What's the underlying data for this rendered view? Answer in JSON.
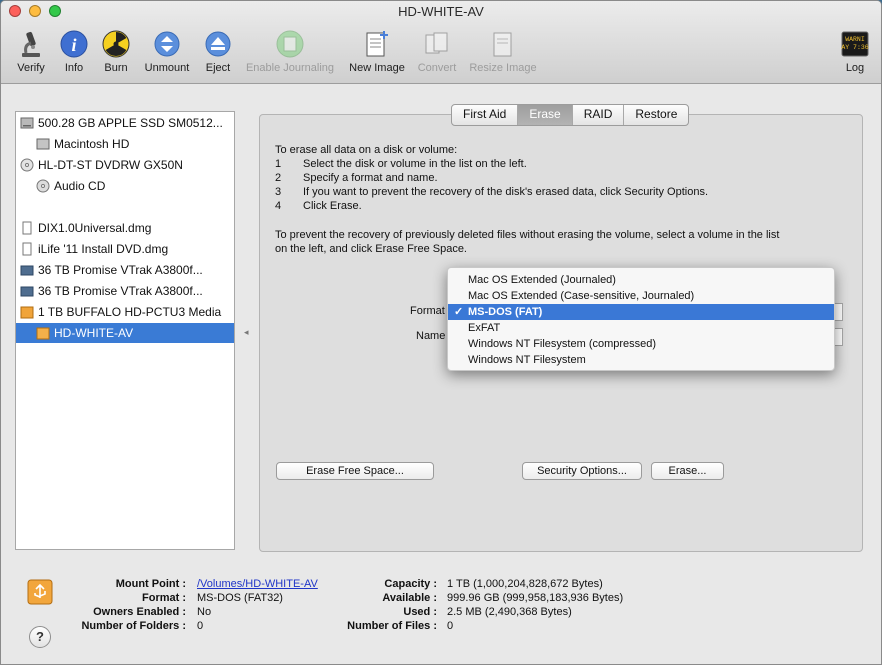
{
  "window": {
    "title": "HD-WHITE-AV"
  },
  "colors": {
    "close": "#fc605b",
    "minimize": "#fdbc40",
    "zoom": "#34c84a",
    "selection": "#3a7bd5"
  },
  "toolbar": {
    "verify": "Verify",
    "info": "Info",
    "burn": "Burn",
    "unmount": "Unmount",
    "eject": "Eject",
    "enable_journaling": "Enable Journaling",
    "new_image": "New Image",
    "convert": "Convert",
    "resize_image": "Resize Image",
    "log": "Log",
    "log_icon_text": [
      "WARNI",
      "AY 7:36"
    ]
  },
  "sidebar": {
    "items": [
      {
        "label": "500.28 GB APPLE SSD SM0512...",
        "icon": "internal-disk-icon"
      },
      {
        "label": "Macintosh HD",
        "icon": "volume-icon"
      },
      {
        "label": "HL-DT-ST DVDRW GX50N",
        "icon": "optical-drive-icon"
      },
      {
        "label": "Audio CD",
        "icon": "cd-icon"
      },
      {
        "label": "DIX1.0Universal.dmg",
        "icon": "dmg-file-icon"
      },
      {
        "label": "iLife '11 Install DVD.dmg",
        "icon": "dmg-file-icon"
      },
      {
        "label": "36 TB Promise VTrak A3800f...",
        "icon": "external-disk-icon"
      },
      {
        "label": "36 TB Promise VTrak A3800f...",
        "icon": "external-disk-icon"
      },
      {
        "label": "1 TB BUFFALO HD-PCTU3 Media",
        "icon": "usb-disk-icon"
      },
      {
        "label": "HD-WHITE-AV",
        "icon": "usb-volume-icon"
      }
    ]
  },
  "tabs": [
    "First Aid",
    "Erase",
    "RAID",
    "Restore"
  ],
  "erase": {
    "intro": "To erase all data on a disk or volume:",
    "steps": [
      {
        "n": "1",
        "text": "Select the disk or volume in the list on the left."
      },
      {
        "n": "2",
        "text": "Specify a format and name."
      },
      {
        "n": "3",
        "text": "If you want to prevent the recovery of the disk's erased data, click Security Options."
      },
      {
        "n": "4",
        "text": "Click Erase."
      }
    ],
    "free_space_line1": "To prevent the recovery of previously deleted files without erasing the volume, select a volume in the list",
    "free_space_line2": "on the left, and click Erase Free Space.",
    "format_label": "Format",
    "name_label": "Name",
    "format_options": [
      "Mac OS Extended (Journaled)",
      "Mac OS Extended (Case-sensitive, Journaled)",
      "MS-DOS (FAT)",
      "ExFAT",
      "Windows NT Filesystem (compressed)",
      "Windows NT Filesystem"
    ],
    "check_mark": "✓",
    "erase_free_space_button": "Erase Free Space...",
    "security_options_button": "Security Options...",
    "erase_button": "Erase..."
  },
  "info": {
    "mount_point_label": "Mount Point :",
    "mount_point": "/Volumes/HD-WHITE-AV",
    "format_label": "Format :",
    "format": "MS-DOS (FAT32)",
    "owners_label": "Owners Enabled :",
    "owners": "No",
    "folders_label": "Number of Folders :",
    "folders": "0",
    "capacity_label": "Capacity :",
    "capacity": "1 TB (1,000,204,828,672 Bytes)",
    "available_label": "Available :",
    "available": "999.96 GB (999,958,183,936 Bytes)",
    "used_label": "Used :",
    "used": "2.5 MB (2,490,368 Bytes)",
    "files_label": "Number of Files :",
    "files": "0"
  },
  "help": "?"
}
